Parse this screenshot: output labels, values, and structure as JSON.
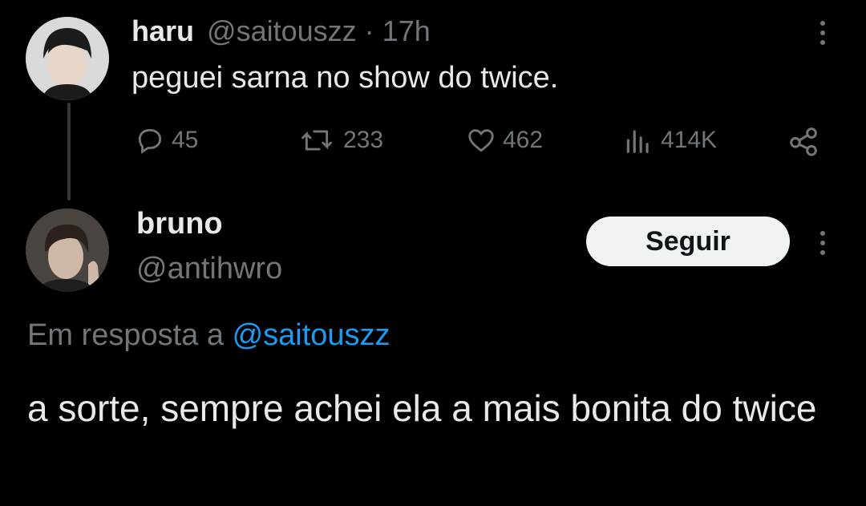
{
  "original_tweet": {
    "display_name": "haru",
    "handle": "@saitouszz",
    "separator": "·",
    "time": "17h",
    "text": "peguei sarna no show do twice.",
    "actions": {
      "replies": "45",
      "retweets": "233",
      "likes": "462",
      "views": "414K"
    }
  },
  "reply": {
    "display_name": "bruno",
    "handle": "@antihwro",
    "follow_label": "Seguir",
    "reply_prefix": "Em resposta a",
    "reply_to": "@saitouszz",
    "text": "a sorte, sempre achei ela a mais bonita do twice"
  },
  "icons": {
    "reply": "reply-icon",
    "retweet": "retweet-icon",
    "like": "like-icon",
    "views": "views-icon",
    "share": "share-icon",
    "more": "more-icon"
  },
  "colors": {
    "background": "#000000",
    "text": "#e7e9ea",
    "muted": "#71767b",
    "link": "#1d9bf0",
    "button_bg": "#eff3f4"
  }
}
